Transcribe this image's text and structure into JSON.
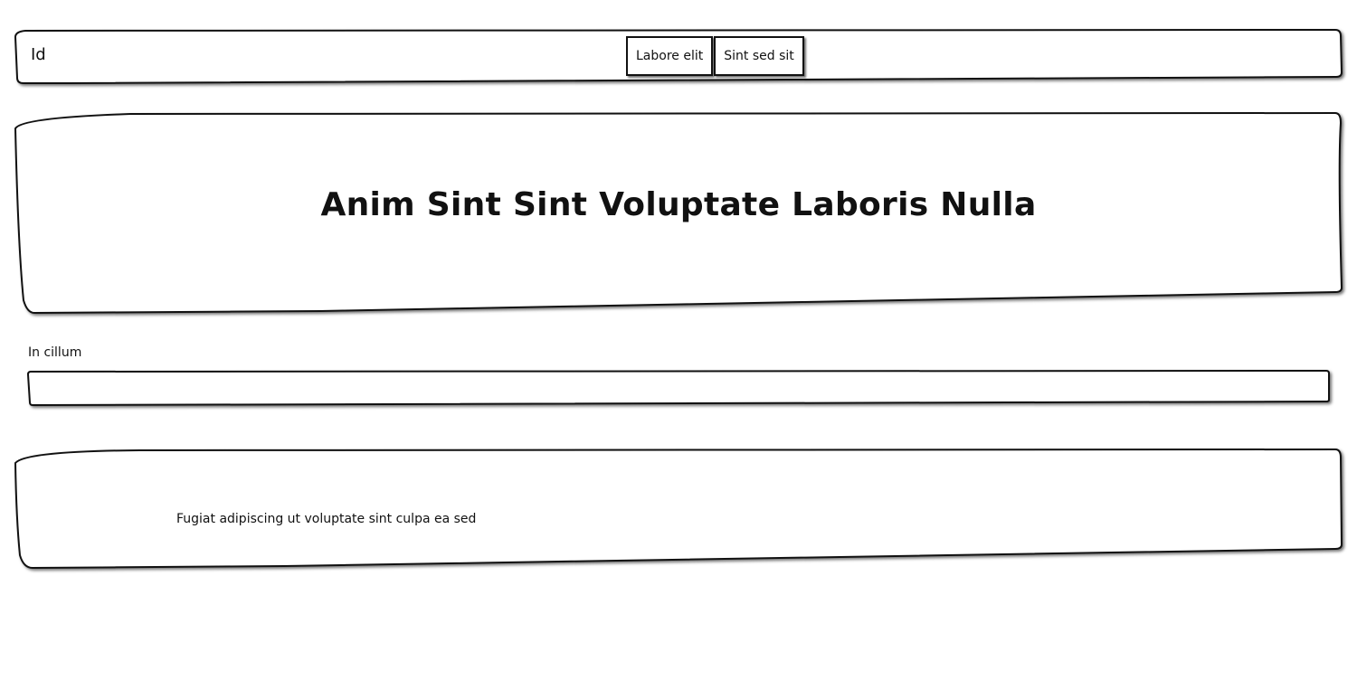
{
  "header": {
    "brand": "Id",
    "nav": [
      {
        "label": "Labore elit"
      },
      {
        "label": "Sint sed sit"
      }
    ]
  },
  "hero": {
    "title": "Anim Sint Sint Voluptate Laboris Nulla"
  },
  "form": {
    "label": "In cillum",
    "value": "",
    "placeholder": ""
  },
  "footer": {
    "text": "Fugiat adipiscing ut voluptate sint culpa ea sed"
  }
}
